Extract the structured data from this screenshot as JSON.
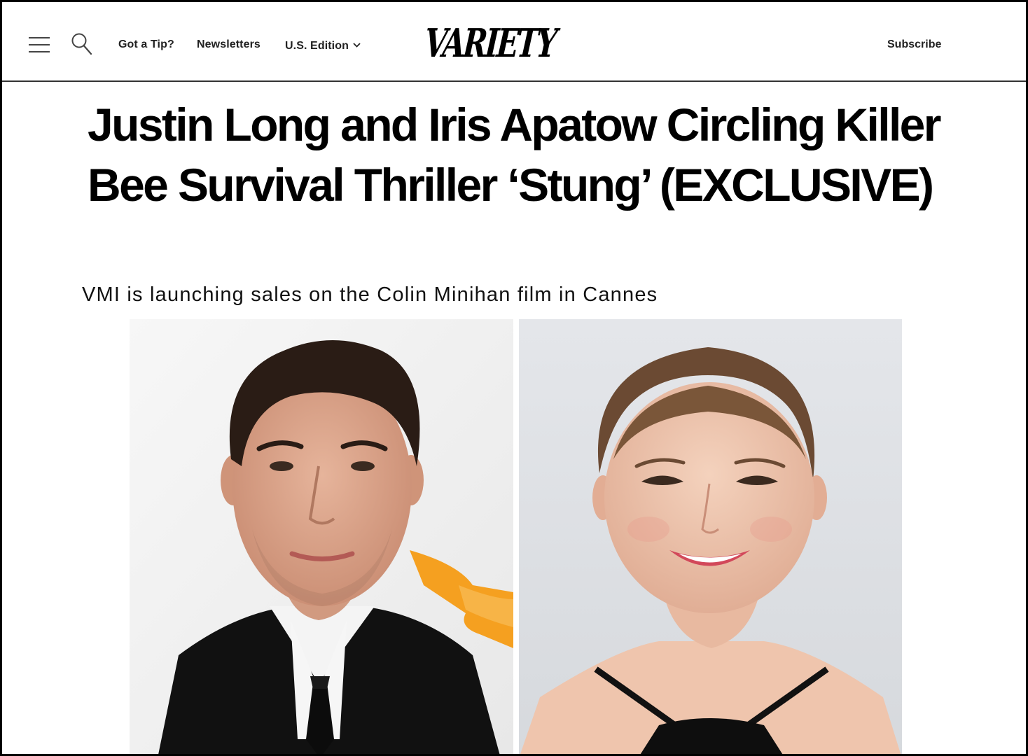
{
  "header": {
    "nav": {
      "tip_label": "Got a Tip?",
      "newsletters_label": "Newsletters",
      "edition_label": "U.S. Edition"
    },
    "logo_text": "VARIETY",
    "subscribe_label": "Subscribe"
  },
  "article": {
    "headline": "Justin Long and Iris Apatow Circling Killer Bee Survival Thriller ‘Stung’ (EXCLUSIVE)",
    "dek": "VMI is launching sales on the Colin Minihan film in Cannes",
    "images": [
      {
        "subject": "Justin Long"
      },
      {
        "subject": "Iris Apatow"
      }
    ]
  },
  "colors": {
    "text": "#000000",
    "header_border": "#333333",
    "orange_backdrop": "#f5a020"
  }
}
